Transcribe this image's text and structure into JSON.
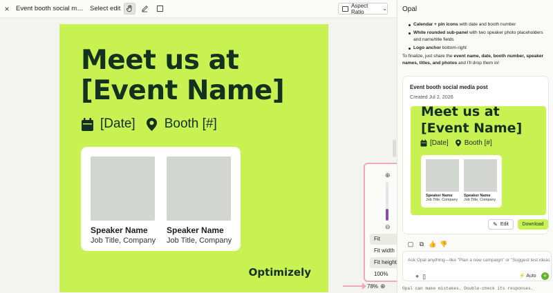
{
  "topbar": {
    "close_icon": "×",
    "title": "Event booth social media post",
    "select_edit_label": "Select edit",
    "tools": [
      "hand-tool",
      "pen-tool",
      "rect-tool"
    ],
    "aspect_label": "Aspect Ratio",
    "aspect_chevron": "⌄"
  },
  "poster": {
    "headline_line1": "Meet us at",
    "headline_line2": "[Event Name]",
    "date_text": "[Date]",
    "booth_text": "Booth [#]",
    "speakers": [
      {
        "name": "Speaker Name",
        "title": "Job Title, Company"
      },
      {
        "name": "Speaker Name",
        "title": "Job Title, Company"
      }
    ],
    "logo_text": "Optimizely",
    "bg_color": "#c8f152",
    "text_color": "#14301e"
  },
  "zoom": {
    "zoom_in_icon": "⊕",
    "zoom_out_icon": "⊖",
    "slider_level_percent": 30,
    "menu": [
      "Fit",
      "Fit width",
      "Fit height",
      "100%"
    ],
    "current_label": "78%",
    "footer_icon": "⊕",
    "highlight_color": "#f0a7b6"
  },
  "panel": {
    "title": "Opal",
    "bullets": [
      {
        "bold": "Calendar + pin icons",
        "rest": " with date and booth number"
      },
      {
        "bold": "White rounded sub-panel",
        "rest": " with two speaker photo placeholders and name/title fields"
      },
      {
        "bold": "Logo anchor",
        "rest": " bottom-right"
      }
    ],
    "para_start": "To finalize, just share the ",
    "para_bold": "event name, date, booth number, speaker names, titles, and photos",
    "para_end": " and I'll drop them in!",
    "card": {
      "title": "Event booth social media post",
      "created": "Created Jul 2, 2026",
      "edit_label": "Edit",
      "edit_icon": "✎",
      "download_label": "Download"
    },
    "actions": [
      "▢",
      "⧉",
      "👍",
      "👎"
    ],
    "input_placeholder": "Ask Opal anything—like \"Plan a new campaign\" or \"Suggest test ideas\"",
    "input_tools": [
      "⌖",
      "▯"
    ],
    "auto_label": "Auto",
    "auto_icon": "⚡",
    "send_icon": "+",
    "footer": "Opal can make mistakes. Double-check its responses."
  }
}
